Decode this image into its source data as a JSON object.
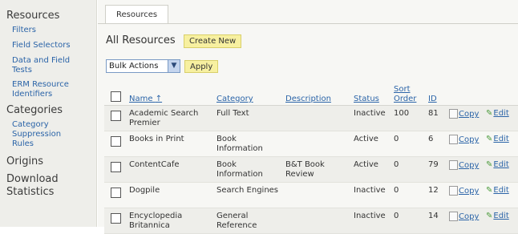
{
  "sidebar": {
    "sections": [
      {
        "title": "Resources",
        "items": [
          "Filters",
          "Field Selectors",
          "Data and Field Tests",
          "ERM Resource Identifiers"
        ]
      },
      {
        "title": "Categories",
        "items": [
          "Category Suppression Rules"
        ]
      },
      {
        "title": "Origins",
        "items": []
      },
      {
        "title": "Download Statistics",
        "items": []
      }
    ]
  },
  "tab": {
    "label": "Resources"
  },
  "page": {
    "title": "All Resources",
    "create_label": "Create New"
  },
  "bulk": {
    "selected": "Bulk Actions",
    "apply_label": "Apply"
  },
  "table": {
    "headers": {
      "name": "Name",
      "category": "Category",
      "description": "Description",
      "status": "Status",
      "sort_order": "Sort Order",
      "id": "ID"
    },
    "actions": {
      "copy": "Copy",
      "edit": "Edit"
    },
    "rows": [
      {
        "name": "Academic Search Premier",
        "category": "Full Text",
        "description": "",
        "status": "Inactive",
        "sort_order": "100",
        "id": "81"
      },
      {
        "name": "Books in Print",
        "category": "Book Information",
        "description": "",
        "status": "Active",
        "sort_order": "0",
        "id": "6"
      },
      {
        "name": "ContentCafe",
        "category": "Book Information",
        "description": "B&T Book Review",
        "status": "Active",
        "sort_order": "0",
        "id": "79"
      },
      {
        "name": "Dogpile",
        "category": "Search Engines",
        "description": "",
        "status": "Inactive",
        "sort_order": "0",
        "id": "12"
      },
      {
        "name": "Encyclopedia Britannica",
        "category": "General Reference",
        "description": "",
        "status": "Inactive",
        "sort_order": "0",
        "id": "14"
      }
    ]
  }
}
